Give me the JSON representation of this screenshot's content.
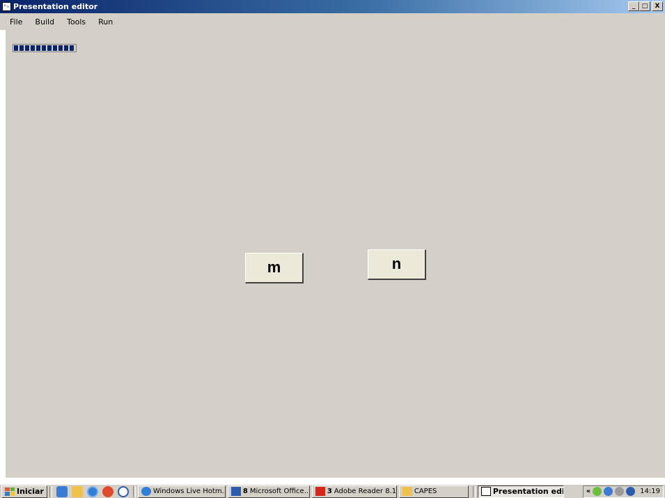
{
  "window": {
    "title": "Presentation editor",
    "icon": "presentation-app-icon",
    "controls": {
      "minimize": "_",
      "restore": "□",
      "close": "X"
    }
  },
  "menu": [
    "File",
    "Build",
    "Tools",
    "Run"
  ],
  "progress": {
    "segments_filled": 11,
    "segments_total": 11
  },
  "stimuli": {
    "left_label": "m",
    "right_label": "n"
  },
  "taskbar": {
    "start_label": "Iniciar",
    "quick_launch": [
      "desktop-icon",
      "folder-icon",
      "ie-icon",
      "media-icon",
      "player-icon"
    ],
    "tasks": [
      {
        "label": "Windows Live Hotm...",
        "icon": "ie-icon",
        "prefix": ""
      },
      {
        "label": "Microsoft Office...",
        "icon": "word-icon",
        "prefix": "8"
      },
      {
        "label": "Adobe Reader 8.1",
        "icon": "acrobat-icon",
        "prefix": "3"
      },
      {
        "label": "CAPES",
        "icon": "folder-icon",
        "prefix": ""
      },
      {
        "label": "Presentation edit...",
        "icon": "presentation-app-icon",
        "prefix": ""
      }
    ],
    "tray_chevron": "«",
    "clock": "14:19"
  },
  "colors": {
    "face": "#d4d0c8",
    "title_start": "#0a246a",
    "title_end": "#a6caf0",
    "progress": "#0a246a"
  }
}
